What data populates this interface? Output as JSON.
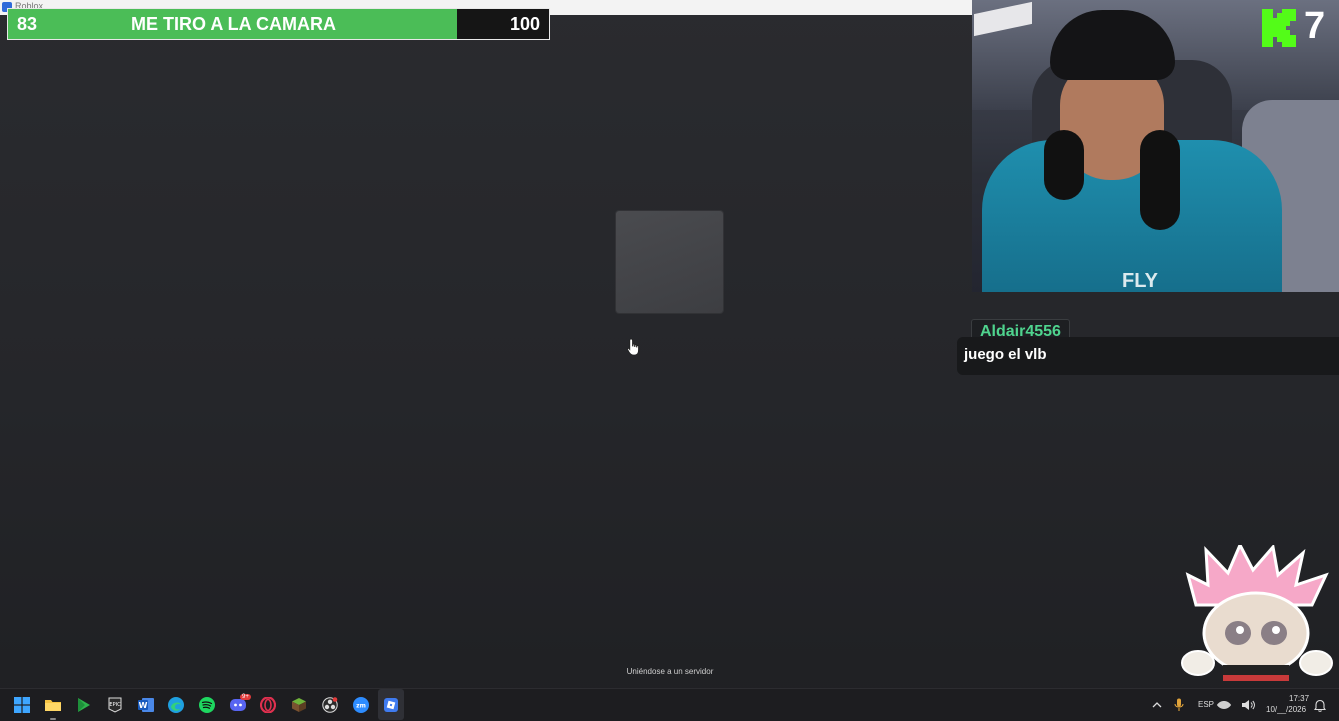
{
  "window": {
    "title": "Roblox"
  },
  "goal_bar": {
    "current": "83",
    "label": "ME TIRO A LA CAMARA",
    "max": "100",
    "progress": 0.83,
    "fill_color": "#4bbd57"
  },
  "loading": {
    "status": "Uniéndose a un servidor"
  },
  "kick": {
    "count": "7",
    "brand_color": "#53fc18"
  },
  "chat": {
    "username": "Aldair4556",
    "message": "juego el vlb",
    "username_color": "#4fd48e"
  },
  "taskbar": {
    "apps": [
      "windows-start-icon",
      "file-explorer-icon",
      "google-play-games-icon",
      "epic-games-icon",
      "word-icon",
      "edge-icon",
      "spotify-icon",
      "discord-icon",
      "opera-gx-icon",
      "minecraft-icon",
      "obs-icon",
      "zoom-icon",
      "roblox-icon"
    ],
    "discord_badge": "9+",
    "language": "ESP",
    "time": "17:37",
    "date": "10/__/2026"
  }
}
